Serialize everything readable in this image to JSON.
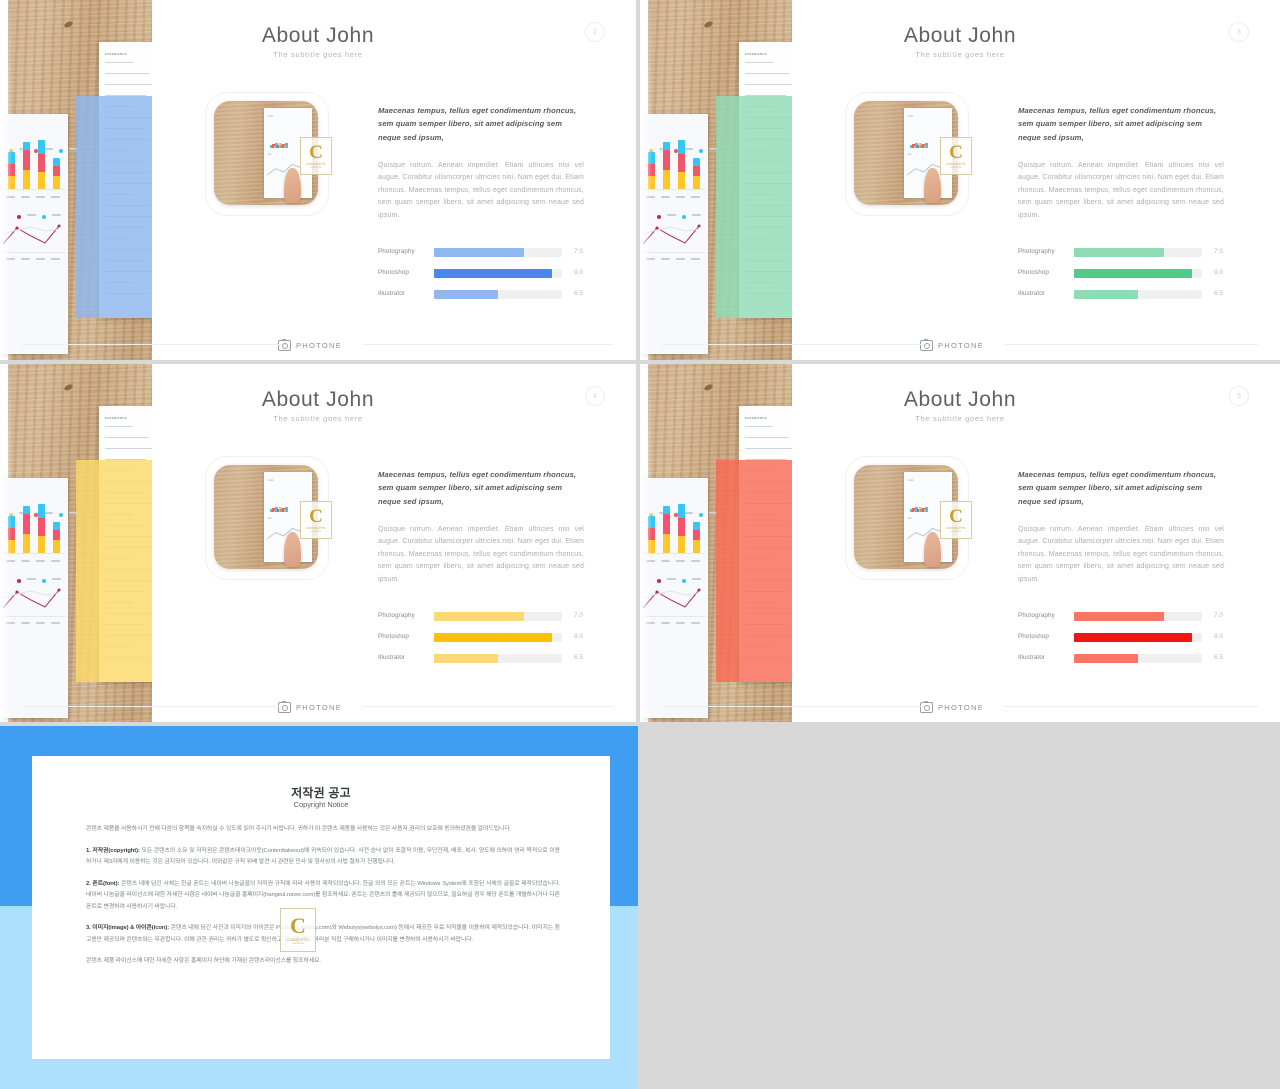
{
  "meta": {
    "deck_title": "About John",
    "subtitle": "The subtitle goes here"
  },
  "theme_colors": {
    "blue_light": "#8fb8f0",
    "blue": "#4a87e8",
    "green_light": "#8fdcb4",
    "green": "#53c98a",
    "yellow_light": "#fad873",
    "yellow": "#fbc107",
    "red_light": "#fa7565",
    "red": "#f01414",
    "gold": "#c6a22c",
    "panel_blue": "#3f9ef2",
    "panel_blue_soft": "#ade0fd"
  },
  "slides": [
    {
      "page": "2",
      "title": "About John",
      "subtitle": "The subtitle goes here",
      "accent": "#4a87e8",
      "accent_soft": "#8fb8f0",
      "overlay": "#8db7ef",
      "lead": "Maecenas tempus, tellus eget condimentum rhoncus, sem quam semper libero, sit amet adipiscing sem neque sed ipsum,",
      "body": "Quisque rutrum.  Aenean imperdiet.  Etiam ultricies nisi vel augue.  Curabitur ullamcorper ultricies nisi. Nam eget dui. Etiam rhoncus. Maecenas tempus, tellus eget condimentum  rhoncus, sem quam semper libero, sit amet  adipiscing  sem  neaue  sed  ipsum.",
      "skills": [
        {
          "label": "Photography",
          "value": "7.0",
          "pct": 70,
          "tone": "soft"
        },
        {
          "label": "Photoshop",
          "value": "9.0",
          "pct": 92,
          "tone": "strong"
        },
        {
          "label": "Illustrator",
          "value": "6.5",
          "pct": 50,
          "tone": "soft"
        }
      ],
      "footer": "PHOTONE"
    },
    {
      "page": "3",
      "title": "About John",
      "subtitle": "The subtitle goes here",
      "accent": "#53c98a",
      "accent_soft": "#8fdcb4",
      "overlay": "#8fdcb4",
      "lead": "Maecenas tempus, tellus eget condimentum rhoncus, sem quam semper libero, sit amet adipiscing sem neque sed ipsum,",
      "body": "Quisque rutrum.  Aenean imperdiet.  Etiam ultricies nisi vel augue.  Curabitur ullamcorper ultricies nisi. Nam eget dui. Etiam rhoncus. Maecenas tempus, tellus eget condimentum  rhoncus, sem quam semper libero, sit amet  adipiscing  sem  neaue  sed  ipsum.",
      "skills": [
        {
          "label": "Photography",
          "value": "7.0",
          "pct": 70,
          "tone": "soft"
        },
        {
          "label": "Photoshop",
          "value": "9.0",
          "pct": 92,
          "tone": "strong"
        },
        {
          "label": "Illustrator",
          "value": "6.5",
          "pct": 50,
          "tone": "soft"
        }
      ],
      "footer": "PHOTONE"
    },
    {
      "page": "4",
      "title": "About John",
      "subtitle": "The subtitle goes here",
      "accent": "#fbc107",
      "accent_soft": "#fad873",
      "overlay": "#fbd969",
      "lead": "Maecenas tempus, tellus eget condimentum rhoncus, sem quam semper libero, sit amet adipiscing sem neque sed ipsum,",
      "body": "Quisque rutrum.  Aenean imperdiet.  Etiam ultricies nisi vel augue.  Curabitur ullamcorper ultricies nisi. Nam eget dui. Etiam rhoncus. Maecenas tempus, tellus eget condimentum  rhoncus, sem quam semper libero, sit amet  adipiscing  sem  neaue  sed  ipsum.",
      "skills": [
        {
          "label": "Photography",
          "value": "7.0",
          "pct": 70,
          "tone": "soft"
        },
        {
          "label": "Photoshop",
          "value": "9.0",
          "pct": 92,
          "tone": "strong"
        },
        {
          "label": "Illustrator",
          "value": "6.5",
          "pct": 50,
          "tone": "soft"
        }
      ],
      "footer": "PHOTONE"
    },
    {
      "page": "5",
      "title": "About John",
      "subtitle": "The subtitle goes here",
      "accent": "#f01414",
      "accent_soft": "#fa7565",
      "overlay": "#fa6a55",
      "lead": "Maecenas tempus, tellus eget condimentum rhoncus, sem quam semper libero, sit amet adipiscing sem neque sed ipsum,",
      "body": "Quisque rutrum.  Aenean imperdiet.  Etiam ultricies nisi vel augue.  Curabitur ullamcorper ultricies nisi. Nam eget dui. Etiam rhoncus. Maecenas tempus, tellus eget condimentum  rhoncus, sem quam semper libero, sit amet  adipiscing  sem  neaue  sed  ipsum.",
      "skills": [
        {
          "label": "Photography",
          "value": "7.0",
          "pct": 70,
          "tone": "soft"
        },
        {
          "label": "Photoshop",
          "value": "9.0",
          "pct": 92,
          "tone": "strong"
        },
        {
          "label": "Illustrator",
          "value": "6.5",
          "pct": 50,
          "tone": "soft"
        }
      ],
      "footer": "PHOTONE"
    }
  ],
  "watermark": {
    "letter": "C",
    "line1": "CONCEPTS",
    "line2": "contents"
  },
  "doc_heading": "EXPERIENCE",
  "copyright_slide": {
    "title": "저작권 공고",
    "subtitle": "Copyright Notice",
    "paragraphs": [
      "콘텐츠 제품을 사용하시기 전에 다음의 항목을 숙지하실 수 있도록 읽어 주시기 바랍니다. 귀하가 이 콘텐츠 제품을 사용하는 것은 사용자 권리의 보호에 동의하셨음을 알려드립니다.",
      "1. 저작권(copyright): 모든 콘텐츠의 소유 및 저작권은 콘텐츠테이크아웃(Contenttakeout)에 귀속되어 있습니다. 사전 승낙 없이 포괄적 이용, 무단전재, 배포, 복사, 양도에 의하여 영리 목적으로 이용하거나 제3자에게 이용하는 것은 금지되어 있습니다. 이와같은 규칙 위배 발견 시 관련된 민사 및 형사상의 사법 절차가 진행됩니다.",
      "2. 폰트(font): 콘텐츠 내에 담긴 서체는 한글 폰트는 네이버 나눔글꼴의 저작권 규칙에 따라 사용이 제작되었습니다. 한글 외의 모든 폰트는 Windows System에 포함된 서체의 글꼴로 제작되었습니다. 네이버 나눔글꼴 라이선스에 대한 자세한 사항은 네이버 나눔글꼴 홈페이지(hangeul.naver.com)를 참조하세요. 폰트는 콘텐츠의 틀에 제공되지 않으므로, 필요하실 경우 해당 폰트를 개별하시거나 다른 폰트로 변경하여 사용하시기 바랍니다.",
      "3. 이미지(image) & 아이콘(icon): 콘텐츠 내에 담긴 사진과 이미지와 아이콘은 Pixabay(pixabay.com)와 Webolys(webolys.com) 등에서 제공한 무료 저작물을 이용하여 제작되었습니다. 이미지는 참고용만 제공되며 콘텐츠와는 무관합니다. 이에 관한 권리는 귀하가 별도로 확인하고 필요할 경우 여러분 직접 구매하시거나 이미지를 변경하여 사용하시기 바랍니다.",
      "콘텐츠 제품 라이선스에 대한 자세한 사항은 홈페이지 하단에 기재된 콘텐츠라이선스를 참조하세요."
    ]
  }
}
